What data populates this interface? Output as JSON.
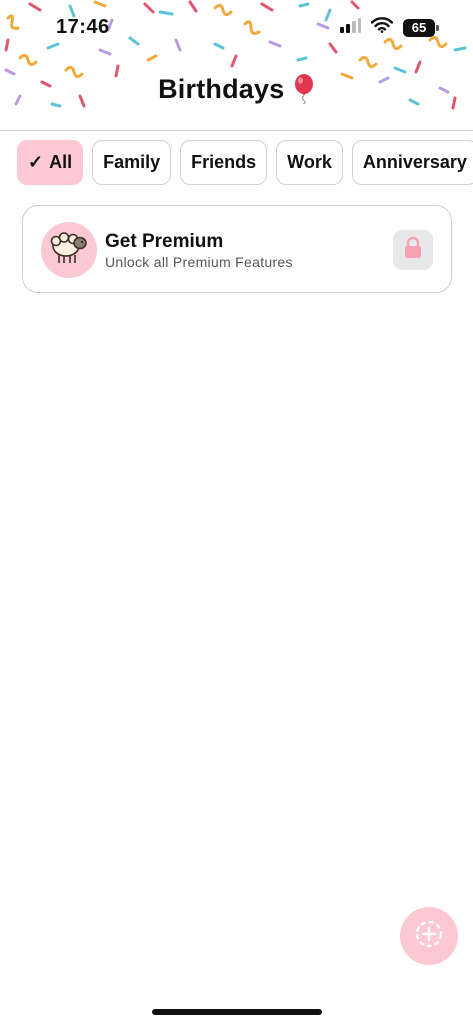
{
  "status_bar": {
    "time": "17:46",
    "battery": "65",
    "icons": [
      "signal-icon",
      "wifi-icon",
      "battery-icon"
    ]
  },
  "header": {
    "title": "Birthdays",
    "title_emoji": "balloon-icon"
  },
  "filters": {
    "selected_index": 0,
    "check_icon": "✓",
    "items": [
      {
        "label": "All"
      },
      {
        "label": "Family"
      },
      {
        "label": "Friends"
      },
      {
        "label": "Work"
      },
      {
        "label": "Anniversary"
      }
    ]
  },
  "premium_card": {
    "title": "Get Premium",
    "subtitle": "Unlock all Premium Features",
    "avatar_icon": "sheep-icon",
    "action_icon": "lock-icon"
  },
  "fab": {
    "icon": "add-circle-icon"
  },
  "colors": {
    "accent_pink": "#fcc9d2",
    "lock_pink": "#f7a1b2",
    "text": "#111111",
    "muted": "#555555",
    "border": "#d2d2d2"
  }
}
